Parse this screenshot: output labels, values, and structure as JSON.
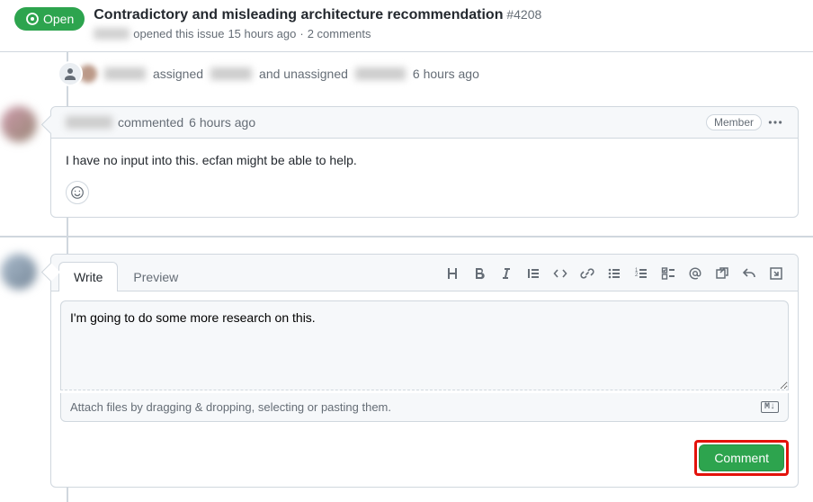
{
  "header": {
    "state": "Open",
    "title": "Contradictory and misleading architecture recommendation",
    "number": "#4208",
    "meta_action": "opened this issue",
    "meta_time": "15 hours ago",
    "meta_comments": "2 comments"
  },
  "assign_event": {
    "assigned_word": "assigned",
    "unassigned_word": "and unassigned",
    "time": "6 hours ago"
  },
  "comment": {
    "action": "commented",
    "time": "6 hours ago",
    "badge": "Member",
    "body": "I have no input into this. ecfan might be able to help."
  },
  "compose": {
    "tab_write": "Write",
    "tab_preview": "Preview",
    "text": "I'm going to do some more research on this.",
    "attach_hint": "Attach files by dragging & dropping, selecting or pasting them.",
    "md_badge": "M↓",
    "submit": "Comment"
  }
}
